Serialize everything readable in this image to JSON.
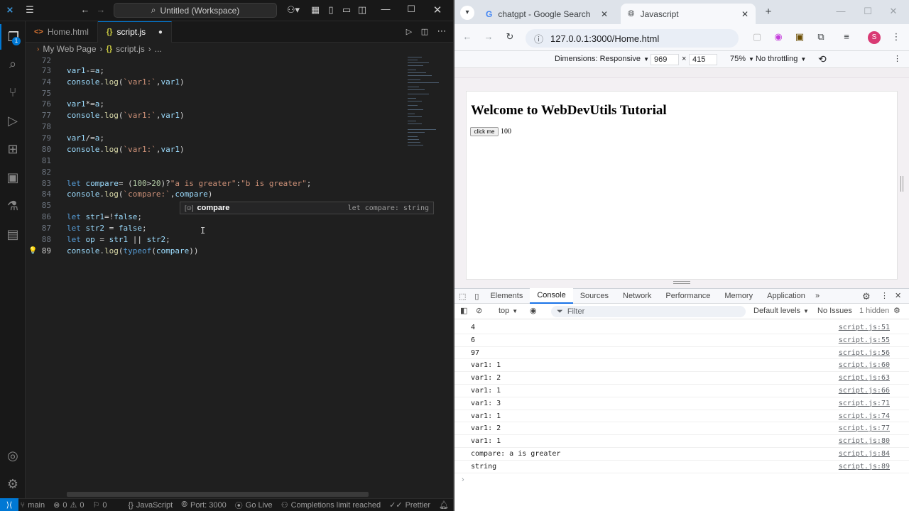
{
  "vscode": {
    "search_text": "Untitled (Workspace)",
    "tabs": [
      {
        "label": "Home.html"
      },
      {
        "label": "script.js"
      }
    ],
    "breadcrumb": [
      "My Web Page",
      "script.js",
      "..."
    ],
    "lines": [
      {
        "n": "72",
        "text": ""
      },
      {
        "n": "73",
        "text": "var1-=a;"
      },
      {
        "n": "74",
        "text": "console.log(`var1:`,var1)"
      },
      {
        "n": "75",
        "text": ""
      },
      {
        "n": "76",
        "text": "var1*=a;"
      },
      {
        "n": "77",
        "text": "console.log(`var1:`,var1)"
      },
      {
        "n": "78",
        "text": ""
      },
      {
        "n": "79",
        "text": "var1/=a;"
      },
      {
        "n": "80",
        "text": "console.log(`var1:`,var1)"
      },
      {
        "n": "81",
        "text": ""
      },
      {
        "n": "82",
        "text": ""
      },
      {
        "n": "83",
        "text": "let compare= (100>20)?\"a is greater\":\"b is greater\";"
      },
      {
        "n": "84",
        "text": "console.log(`compare:`,compare)"
      },
      {
        "n": "85",
        "text": ""
      },
      {
        "n": "86",
        "text": "let str1=!false;"
      },
      {
        "n": "87",
        "text": "let str2 = false;"
      },
      {
        "n": "88",
        "text": "let op = str1 || str2;"
      },
      {
        "n": "89",
        "text": "console.log(typeof(compare))"
      }
    ],
    "suggestion": {
      "name": "compare",
      "type": "let compare: string"
    },
    "status": {
      "branch": "main",
      "errors": "0",
      "warnings": "0",
      "infos": "0",
      "language": "JavaScript",
      "port": "Port: 3000",
      "golive": "Go Live",
      "completions": "Completions limit reached",
      "prettier": "Prettier"
    }
  },
  "chrome": {
    "tabs": [
      {
        "label": "chatgpt - Google Search"
      },
      {
        "label": "Javascript"
      }
    ],
    "url": "127.0.0.1:3000/Home.html",
    "profile_initial": "S",
    "device": {
      "dimensions": "Dimensions: Responsive",
      "width": "969",
      "height": "415",
      "zoom": "75%",
      "throttle": "No throttling"
    },
    "page": {
      "heading": "Welcome to WebDevUtils Tutorial",
      "button": "click me",
      "output": "100"
    },
    "devtools": {
      "tabs": [
        "Elements",
        "Console",
        "Sources",
        "Network",
        "Performance",
        "Memory",
        "Application"
      ],
      "context": "top",
      "filter_placeholder": "Filter",
      "levels": "Default levels",
      "issues": "No Issues",
      "hidden": "1 hidden",
      "console_rows": [
        {
          "msg": "4",
          "src": "script.js:51"
        },
        {
          "msg": "6",
          "src": "script.js:55"
        },
        {
          "msg": "97",
          "src": "script.js:56"
        },
        {
          "msg": "var1: 1",
          "src": "script.js:60"
        },
        {
          "msg": "var1: 2",
          "src": "script.js:63"
        },
        {
          "msg": "var1: 1",
          "src": "script.js:66"
        },
        {
          "msg": "var1: 3",
          "src": "script.js:71"
        },
        {
          "msg": "var1: 1",
          "src": "script.js:74"
        },
        {
          "msg": "var1: 2",
          "src": "script.js:77"
        },
        {
          "msg": "var1: 1",
          "src": "script.js:80"
        },
        {
          "msg": "compare: a is greater",
          "src": "script.js:84"
        },
        {
          "msg": "string",
          "src": "script.js:89"
        }
      ]
    }
  }
}
